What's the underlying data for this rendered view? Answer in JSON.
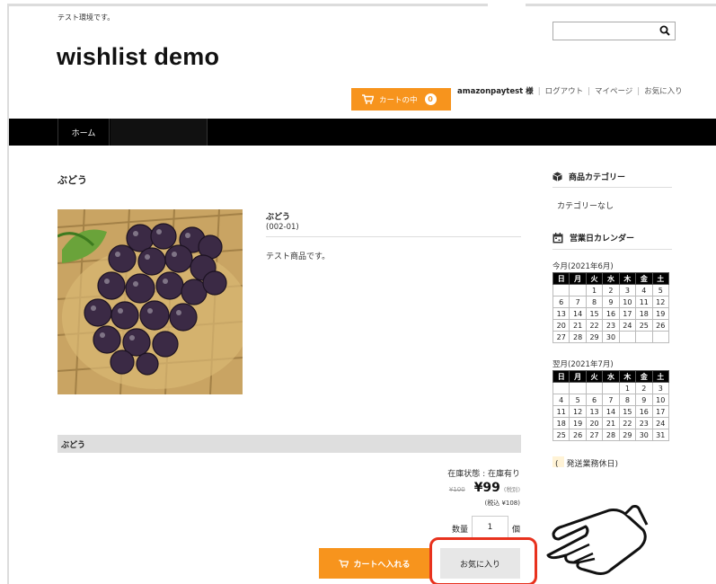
{
  "header": {
    "tagline": "テスト環境です。",
    "site_title": "wishlist demo",
    "search_placeholder": "",
    "user_name": "amazonpaytest 様",
    "links": [
      "ログアウト",
      "マイページ",
      "お気に入り"
    ],
    "cart_label": "カートの中",
    "cart_count": "0"
  },
  "nav": {
    "home": "ホーム"
  },
  "product": {
    "page_title": "ぶどう",
    "name": "ぶどう",
    "code": "(002-01)",
    "description": "テスト商品です。",
    "class_name": "ぶどう",
    "stock": "在庫状態 : 在庫有り",
    "old_price": "¥100",
    "price": "¥99",
    "tax_note": "(税別)",
    "tax_incl": "(税込 ¥108)",
    "qty_label": "数量",
    "qty_value": "1",
    "qty_unit": "個",
    "add_to_cart": "カートへ入れる",
    "favorite": "お気に入り"
  },
  "sidebar": {
    "category_title": "商品カテゴリー",
    "category_none": "カテゴリーなし",
    "calendar_title": "営業日カレンダー",
    "weekdays": [
      "日",
      "月",
      "火",
      "水",
      "木",
      "金",
      "土"
    ],
    "cal1_title": "今月(2021年6月)",
    "cal1_rows": [
      [
        "",
        "",
        "1",
        "2",
        "3",
        "4",
        "5"
      ],
      [
        "6",
        "7",
        "8",
        "9",
        "10",
        "11",
        "12"
      ],
      [
        "13",
        "14",
        "15",
        "16",
        "17",
        "18",
        "19"
      ],
      [
        "20",
        "21",
        "22",
        "23",
        "24",
        "25",
        "26"
      ],
      [
        "27",
        "28",
        "29",
        "30",
        "",
        "",
        ""
      ]
    ],
    "cal2_title": "翌月(2021年7月)",
    "cal2_rows": [
      [
        "",
        "",
        "",
        "",
        "1",
        "2",
        "3"
      ],
      [
        "4",
        "5",
        "6",
        "7",
        "8",
        "9",
        "10"
      ],
      [
        "11",
        "12",
        "13",
        "14",
        "15",
        "16",
        "17"
      ],
      [
        "18",
        "19",
        "20",
        "21",
        "22",
        "23",
        "24"
      ],
      [
        "25",
        "26",
        "27",
        "28",
        "29",
        "30",
        "31"
      ]
    ],
    "legend": "(　発送業務休日)"
  },
  "colors": {
    "accent": "#f7941d",
    "highlight": "#e8321e",
    "nav": "#000000"
  }
}
